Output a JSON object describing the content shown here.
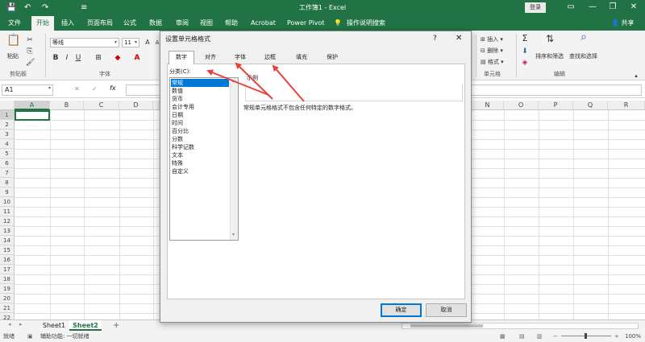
{
  "app": {
    "title": "工作簿1 - Excel",
    "login": "登录",
    "share": "共享"
  },
  "quick_access": [
    "💾",
    "↶",
    "↷",
    "≡"
  ],
  "menu": {
    "tabs": [
      "文件",
      "开始",
      "插入",
      "页面布局",
      "公式",
      "数据",
      "审阅",
      "视图",
      "帮助",
      "Acrobat",
      "Power Pivot",
      "操作说明搜索"
    ],
    "active": "开始"
  },
  "ribbon": {
    "clipboard": {
      "paste": "粘贴",
      "label": "剪贴板"
    },
    "font": {
      "name": "等线",
      "size": "11",
      "label": "字体",
      "bold": "B",
      "italic": "I",
      "underline": "U"
    },
    "cells": {
      "insert": "插入",
      "delete": "删除",
      "format": "格式",
      "label": "单元格"
    },
    "editing": {
      "sort_filter": "排序和筛选",
      "find_select": "查找和选择",
      "label": "编辑"
    }
  },
  "formula_bar": {
    "name_box": "A1",
    "cancel": "✕",
    "enter": "✓",
    "fx": "fx",
    "value": ""
  },
  "grid": {
    "columns": [
      "A",
      "B",
      "C",
      "D",
      "N",
      "O",
      "P",
      "Q",
      "R"
    ],
    "rows": [
      "1",
      "2",
      "3",
      "4",
      "5",
      "6",
      "7",
      "8",
      "9",
      "10",
      "11",
      "12",
      "13",
      "14",
      "15",
      "16",
      "17",
      "18",
      "19",
      "20",
      "21",
      "22"
    ],
    "selected_cell": "A1"
  },
  "sheets": {
    "tabs": [
      "Sheet1",
      "Sheet2"
    ],
    "active": "Sheet2",
    "add": "+"
  },
  "status": {
    "ready": "就绪",
    "accessibility": "辅助功能: 一切就绪",
    "zoom": "100%"
  },
  "dialog": {
    "title": "设置单元格格式",
    "help": "?",
    "close": "✕",
    "tabs": [
      "数字",
      "对齐",
      "字体",
      "边框",
      "填充",
      "保护"
    ],
    "active_tab": "数字",
    "category_label": "分类(C):",
    "categories": [
      "常规",
      "数值",
      "货币",
      "会计专用",
      "日期",
      "时间",
      "百分比",
      "分数",
      "科学记数",
      "文本",
      "特殊",
      "自定义"
    ],
    "selected_category": "常规",
    "sample_label": "示例",
    "description": "常规单元格格式不包含任何特定的数字格式。",
    "ok": "确定",
    "cancel": "取消"
  },
  "colors": {
    "excel_green": "#217346",
    "annotation_red": "#e8413c",
    "selection_blue": "#0078d7"
  }
}
